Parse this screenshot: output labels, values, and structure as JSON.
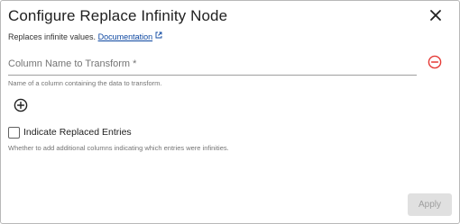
{
  "dialog": {
    "title": "Configure Replace Infinity Node",
    "subtitle_text": "Replaces infinite values.",
    "documentation_link": "Documentation"
  },
  "column_field": {
    "placeholder": "Column Name to Transform *",
    "value": "",
    "helper_text": "Name of a column containing the data to transform."
  },
  "indicate_replaced": {
    "label": "Indicate Replaced Entries",
    "checked": false,
    "helper_text": "Whether to add additional columns indicating which entries were infinities."
  },
  "actions": {
    "apply_label": "Apply",
    "apply_enabled": false
  },
  "icons": {
    "close": "close-icon",
    "external_link": "external-link-icon",
    "remove_column": "remove-circle-icon",
    "add_column": "add-circle-icon"
  },
  "colors": {
    "link": "#0d47a1",
    "remove_icon": "#e53935",
    "text": "#212121",
    "helper_text": "#757575",
    "disabled_button_bg": "#e0e0e0",
    "disabled_button_text": "#9e9e9e"
  }
}
